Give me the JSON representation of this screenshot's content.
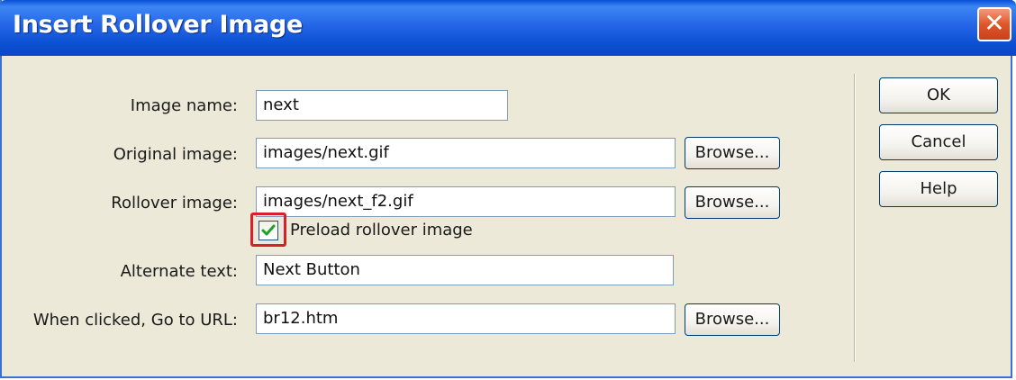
{
  "window": {
    "title": "Insert Rollover Image",
    "close_icon": "close-icon"
  },
  "form": {
    "image_name": {
      "label": "Image name:",
      "value": "next"
    },
    "original_image": {
      "label": "Original image:",
      "value": "images/next.gif",
      "browse": "Browse..."
    },
    "rollover_image": {
      "label": "Rollover image:",
      "value": "images/next_f2.gif",
      "browse": "Browse..."
    },
    "preload": {
      "label": "Preload rollover image",
      "checked": true
    },
    "alternate_text": {
      "label": "Alternate text:",
      "value": "Next Button"
    },
    "go_to_url": {
      "label": "When clicked, Go to URL:",
      "value": "br12.htm",
      "browse": "Browse..."
    }
  },
  "buttons": {
    "ok": "OK",
    "cancel": "Cancel",
    "help": "Help"
  },
  "colors": {
    "titlebar": "#2466e6",
    "highlight": "#d8202a",
    "dialog_bg": "#ece9d8"
  }
}
